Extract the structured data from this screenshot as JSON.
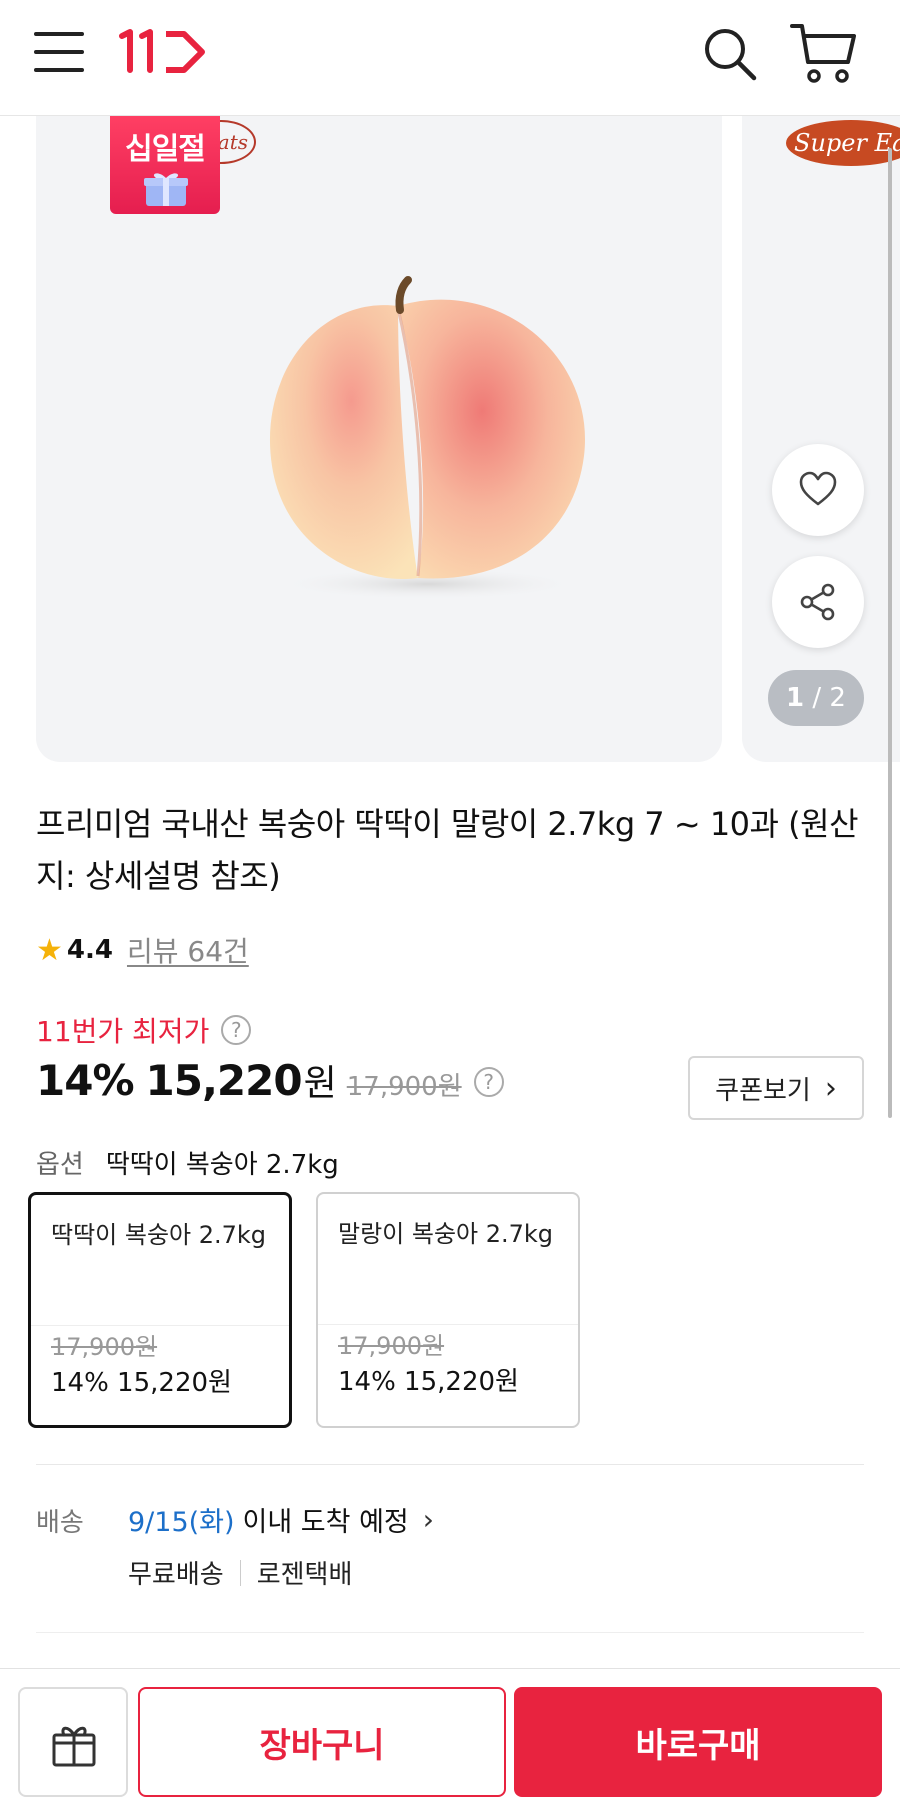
{
  "header": {
    "menu_icon": "hamburger-menu-icon",
    "logo_text": "11",
    "search_icon": "search-icon",
    "cart_icon": "cart-icon"
  },
  "gallery": {
    "badge_text": "십일절",
    "brand_left": "ats",
    "brand_right": "Super Eats",
    "page_current": "1",
    "page_total": "2",
    "wishlist_icon": "heart-icon",
    "share_icon": "share-icon"
  },
  "product": {
    "title": "프리미엄 국내산 복숭아 딱딱이 말랑이 2.7kg 7 ~ 10과 (원산지: 상세설명 참조)",
    "rating": "4.4",
    "review_count": "리뷰 64건",
    "lowest_label": "11번가 최저가",
    "discount": "14%",
    "price": "15,220",
    "won": "원",
    "original_price": "17,900원",
    "coupon_label": "쿠폰보기"
  },
  "options": {
    "label": "옵션",
    "selected_value": "딱딱이 복숭아 2.7kg",
    "items": [
      {
        "name": "딱딱이 복숭아 2.7kg",
        "original": "17,900원",
        "price": "14% 15,220원",
        "selected": true
      },
      {
        "name": "말랑이 복숭아 2.7kg",
        "original": "17,900원",
        "price": "14% 15,220원",
        "selected": false
      }
    ]
  },
  "shipping": {
    "label": "배송",
    "date": "9/15(화)",
    "date_suffix": "이내 도착 예정",
    "free": "무료배송",
    "carrier": "로젠택배"
  },
  "bottom": {
    "gift_icon": "gift-icon",
    "cart_button": "장바구니",
    "buy_button": "바로구매"
  },
  "colors": {
    "accent": "#e8233f",
    "link": "#1c6fc9",
    "star": "#f5b20a"
  }
}
